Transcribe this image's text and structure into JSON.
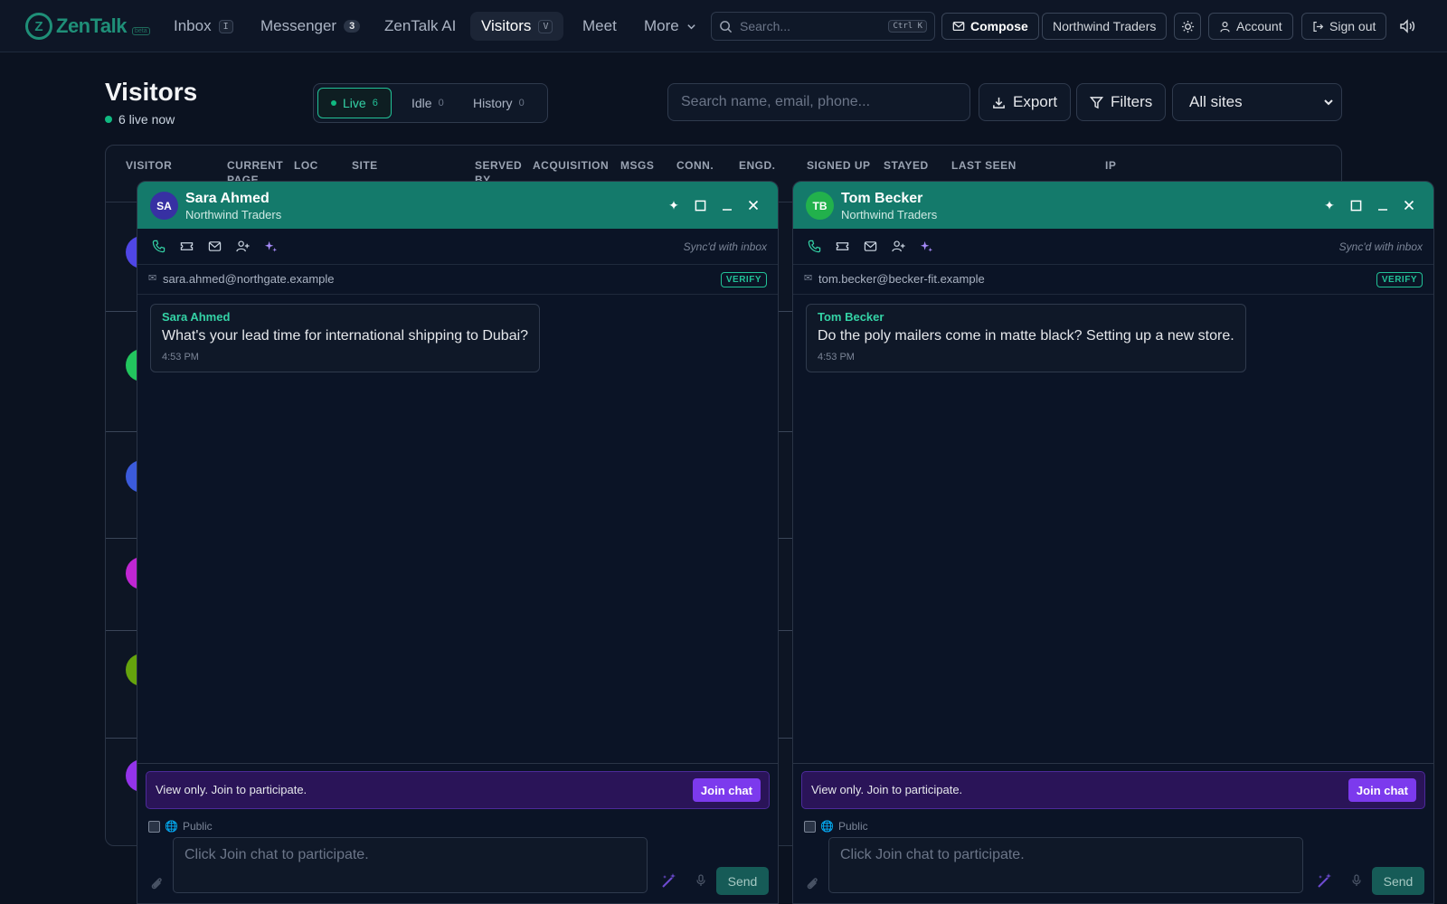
{
  "app": {
    "logo_text": "ZenTalk",
    "logo_badge": "beta"
  },
  "nav": {
    "items": [
      {
        "label": "Inbox",
        "shortcut": "I"
      },
      {
        "label": "Messenger",
        "count": "3"
      },
      {
        "label": "ZenTalk AI"
      },
      {
        "label": "Visitors",
        "shortcut": "V",
        "active": true
      },
      {
        "label": "Meet"
      },
      {
        "label": "More"
      }
    ],
    "search_placeholder": "Search...",
    "search_shortcut": "Ctrl K",
    "compose_label": "Compose",
    "workspace_label": "Northwind Traders",
    "account_label": "Account",
    "signout_label": "Sign out"
  },
  "page": {
    "title": "Visitors",
    "live_now": "6 live now",
    "tabs": [
      {
        "label": "Live",
        "count": "6",
        "active": true
      },
      {
        "label": "Idle",
        "count": "0"
      },
      {
        "label": "History",
        "count": "0"
      }
    ],
    "search_placeholder": "Search name, email, phone...",
    "export_label": "Export",
    "filters_label": "Filters",
    "site_select": "All sites"
  },
  "table": {
    "columns": [
      "VISITOR",
      "CURRENT PAGE",
      "LOC",
      "SITE",
      "SERVED BY",
      "ACQUISITION",
      "MSGS",
      "CONN.",
      "ENGD.",
      "SIGNED UP",
      "STAYED",
      "LAST SEEN",
      "IP"
    ],
    "row_avatar_colors": [
      "#4f46e5",
      "#22c55e",
      "#3b5bdb",
      "#c026d3",
      "#65a30d",
      "#9333ea"
    ]
  },
  "chats": [
    {
      "initials": "SA",
      "avatar_color": "#3730a3",
      "name": "Sara Ahmed",
      "org": "Northwind Traders",
      "synced": "Sync'd with inbox",
      "email": "sara.ahmed@northgate.example",
      "verify": "VERIFY",
      "message": {
        "from": "Sara Ahmed",
        "text": "What's your lead time for international shipping to Dubai?",
        "time": "4:53 PM"
      },
      "view_only": "View only. Join to participate.",
      "join_label": "Join chat",
      "public_label": "Public",
      "composer_placeholder": "Click Join chat to participate.",
      "send_label": "Send"
    },
    {
      "initials": "TB",
      "avatar_color": "#22b14c",
      "name": "Tom Becker",
      "org": "Northwind Traders",
      "synced": "Sync'd with inbox",
      "email": "tom.becker@becker-fit.example",
      "verify": "VERIFY",
      "message": {
        "from": "Tom Becker",
        "text": "Do the poly mailers come in matte black? Setting up a new store.",
        "time": "4:53 PM"
      },
      "view_only": "View only. Join to participate.",
      "join_label": "Join chat",
      "public_label": "Public",
      "composer_placeholder": "Click Join chat to participate.",
      "send_label": "Send"
    }
  ]
}
